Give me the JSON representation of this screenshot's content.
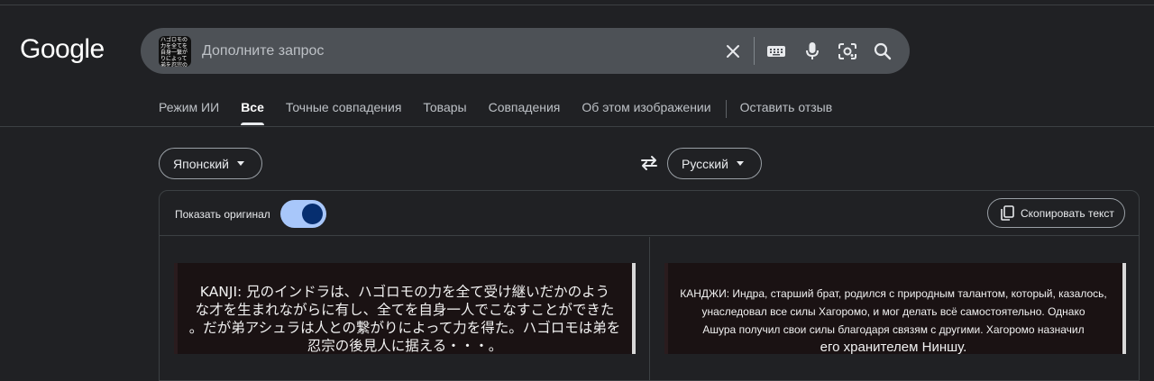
{
  "logo": "Google",
  "search": {
    "placeholder": "Дополните запрос",
    "thumbnail_text": "ハゴロモの力を全てを自身一繋がりによって弟を忍宗の後見人に据"
  },
  "icons": {
    "clear": "close-icon",
    "keyboard": "keyboard-icon",
    "mic": "microphone-icon",
    "lens": "camera-lens-icon",
    "search": "search-icon"
  },
  "tabs": [
    {
      "label": "Режим ИИ",
      "active": false
    },
    {
      "label": "Все",
      "active": true
    },
    {
      "label": "Точные совпадения",
      "active": false
    },
    {
      "label": "Товары",
      "active": false
    },
    {
      "label": "Совпадения",
      "active": false
    },
    {
      "label": "Об этом изображении",
      "active": false
    },
    {
      "label": "Оставить отзыв",
      "active": false
    }
  ],
  "translate": {
    "source_lang": "Японский",
    "target_lang": "Русский",
    "show_original_label": "Показать оригинал",
    "show_original_on": true,
    "copy_label": "Скопировать текст",
    "original_lines": [
      "KANJI: 兄のインドラは、ハゴロモの力を全て受け継いだかのよう",
      "な才を生まれながらに有し、全てを自身一人でこなすことができた",
      "。だが弟アシュラは人との繋がりによって力を得た。ハゴロモは弟を",
      "忍宗の後見人に据える・・・。"
    ],
    "translated_lines": [
      "КАНДЖИ: Индра, старший брат, родился с природным талантом, который, казалось,",
      "унаследовал все силы Хагоромо, и мог делать всё самостоятельно. Однако",
      "Ашура получил свои силы благодаря связям с другими. Хагоромо назначил",
      "его хранителем Ниншу."
    ]
  },
  "colors": {
    "background": "#202124",
    "searchbar": "#4d5156",
    "toggle_track": "#a8c7fa",
    "toggle_knob": "#062e6f"
  }
}
